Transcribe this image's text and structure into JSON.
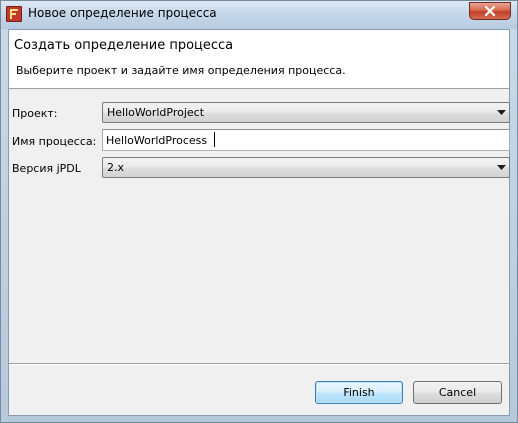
{
  "window": {
    "title": "Новое определение процесса"
  },
  "banner": {
    "title": "Создать определение процесса",
    "description": "Выберите проект и задайте имя определения процесса."
  },
  "form": {
    "project_label": "Проект:",
    "project_value": "HelloWorldProject",
    "process_name_label": "Имя процесса:",
    "process_name_value": "HelloWorldProcess",
    "jpdl_version_label": "Версия jPDL",
    "jpdl_version_value": "2.x"
  },
  "buttons": {
    "finish_label": "Finish",
    "cancel_label": "Cancel"
  },
  "icons": {
    "app": "jbpm-app-icon",
    "close": "close-icon",
    "dropdown": "chevron-down-icon"
  },
  "colors": {
    "title_bar": "#c3d5e8",
    "close_button": "#c3412a",
    "default_button": "#bee6fd",
    "dialog_background": "#f0f0f0"
  }
}
